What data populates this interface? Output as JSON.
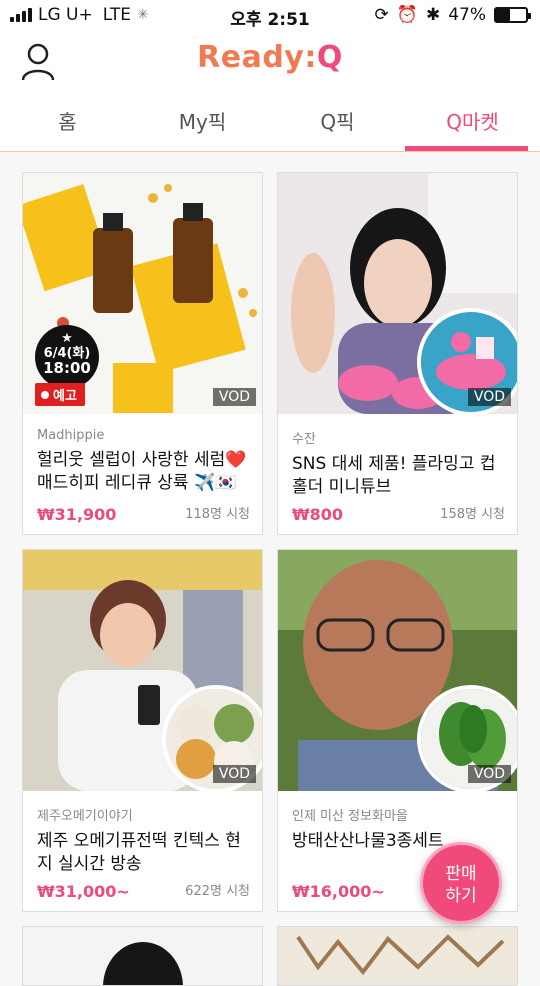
{
  "status_bar": {
    "carrier": "LG U+",
    "network": "LTE",
    "time": "오후 2:51",
    "battery": "47%",
    "battery_level": 0.47
  },
  "app": {
    "logo_main": "Ready:",
    "logo_q": "Q"
  },
  "tabs": [
    {
      "label": "홈"
    },
    {
      "label": "My픽"
    },
    {
      "label": "Q픽"
    },
    {
      "label": "Q마켓",
      "active": true
    }
  ],
  "products": [
    {
      "seller": "Madhippie",
      "title": "헐리웃 셀럽이 사랑한 세럼❤️ 매드히피 레디큐 상륙 ✈️🇰🇷",
      "price": "₩31,900",
      "views": "118명 시청",
      "vod": "VOD",
      "badge_date": "6/4(화)",
      "badge_time": "18:00",
      "badge_star": "★",
      "badge_notice": "예고"
    },
    {
      "seller": "수잔",
      "title": "SNS 대세 제품! 플라밍고 컵홀더 미니튜브",
      "price": "₩800",
      "views": "158명 시청",
      "vod": "VOD"
    },
    {
      "seller": "제주오메기이야기",
      "title": "제주 오메기퓨전떡 킨텍스 현지 실시간 방송",
      "price": "₩31,000~",
      "views": "622명 시청",
      "vod": "VOD"
    },
    {
      "seller": "인제 미산 정보화마을",
      "title": "방태산산나물3종세트",
      "price": "₩16,000~",
      "views": "",
      "vod": "VOD"
    }
  ],
  "fab": {
    "line1": "판매",
    "line2": "하기"
  },
  "colors": {
    "accent": "#f04a7a",
    "logo": "#f07a52"
  }
}
